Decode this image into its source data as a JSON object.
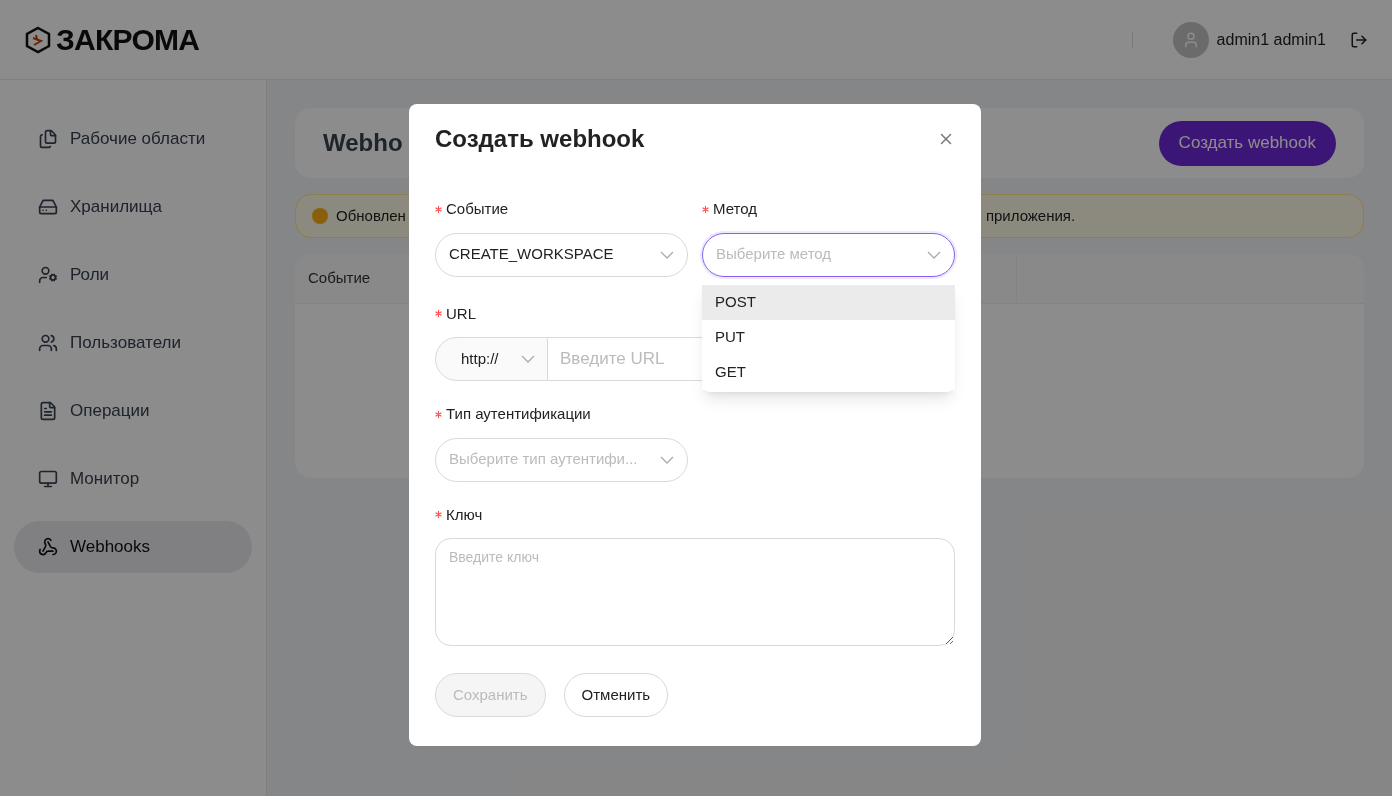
{
  "header": {
    "logo": "ЗАКРОМА",
    "user": "admin1 admin1"
  },
  "sidebar": {
    "items": [
      {
        "label": "Рабочие области",
        "selected": false
      },
      {
        "label": "Хранилища",
        "selected": false
      },
      {
        "label": "Роли",
        "selected": false
      },
      {
        "label": "Пользователи",
        "selected": false
      },
      {
        "label": "Операции",
        "selected": false
      },
      {
        "label": "Монитор",
        "selected": false
      },
      {
        "label": "Webhooks",
        "selected": true
      }
    ]
  },
  "page": {
    "title": "Webho",
    "create_button": "Создать webhook",
    "alert_start": "Обновлен",
    "alert_end": "приложения.",
    "table": {
      "columns": [
        "Событие"
      ]
    }
  },
  "modal": {
    "title": "Создать webhook",
    "event": {
      "label": "Событие",
      "required": true,
      "value": "CREATE_WORKSPACE"
    },
    "method": {
      "label": "Метод",
      "required": true,
      "placeholder": "Выберите метод",
      "focused": true,
      "options": [
        {
          "label": "POST",
          "selected": true
        },
        {
          "label": "PUT",
          "selected": false
        },
        {
          "label": "GET",
          "selected": false
        }
      ]
    },
    "url": {
      "label": "URL",
      "required": true,
      "protocol": "http://",
      "placeholder": "Введите URL"
    },
    "auth": {
      "label": "Тип аутентификации",
      "required": true,
      "placeholder": "Выберите тип аутентифи..."
    },
    "key": {
      "label": "Ключ",
      "required": true,
      "placeholder": "Введите ключ"
    },
    "save": {
      "label": "Сохранить",
      "disabled": true
    },
    "cancel": {
      "label": "Отменить"
    }
  }
}
